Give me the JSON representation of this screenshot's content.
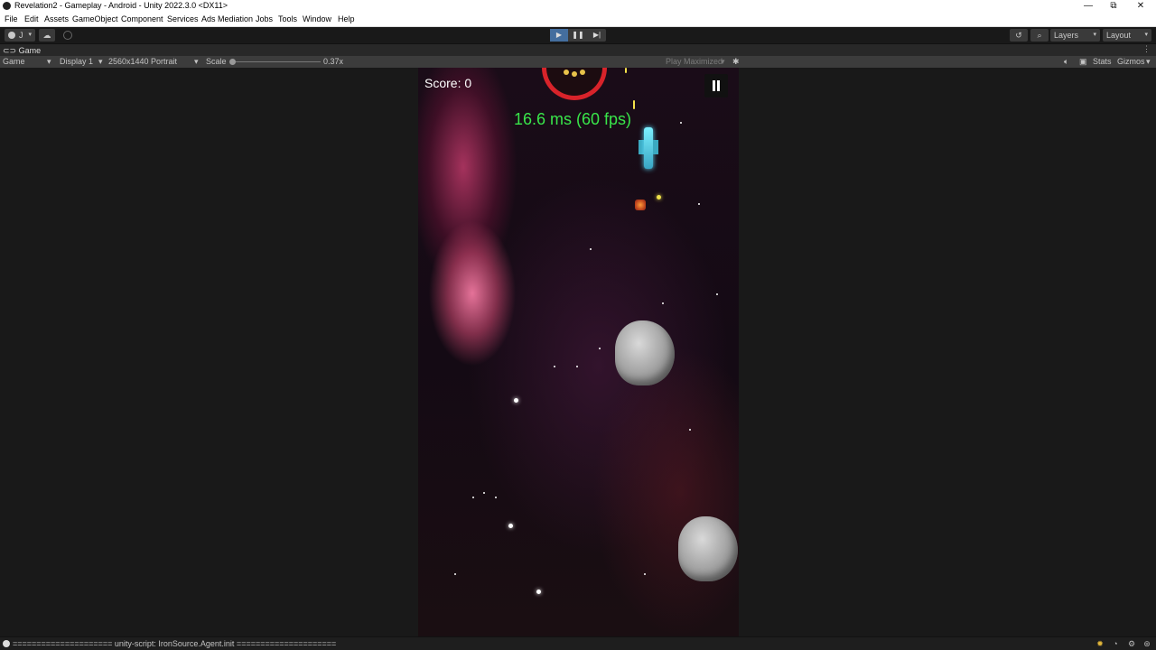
{
  "window": {
    "title": "Revelation2 - Gameplay - Android - Unity 2022.3.0 <DX11>",
    "controls": [
      "—",
      "⧉",
      "✕"
    ]
  },
  "menu": [
    "File",
    "Edit",
    "Assets",
    "GameObject",
    "Component",
    "Services",
    "Ads Mediation",
    "Jobs",
    "Tools",
    "Window",
    "Help"
  ],
  "toolbar": {
    "account_label": "J",
    "layers_label": "Layers",
    "layout_label": "Layout",
    "play_state": "playing"
  },
  "game_tab": {
    "label": "Game"
  },
  "game_bar": {
    "view_label": "Game",
    "display_label": "Display 1",
    "resolution_label": "2560x1440 Portrait",
    "scale_label": "Scale",
    "scale_value": "0.37x",
    "scale_fraction": 0.0,
    "play_maximized_label": "Play Maximized",
    "stats_label": "Stats",
    "gizmos_label": "Gizmos"
  },
  "game": {
    "score_text": "Score: 0",
    "fps_text": "16.6 ms (60 fps)"
  },
  "status": {
    "message": "===================== unity-script: IronSource.Agent.init ====================="
  },
  "colors": {
    "play_active": "#446e9e",
    "fps_text": "#39e64a",
    "boss_ring": "#d8232a"
  }
}
